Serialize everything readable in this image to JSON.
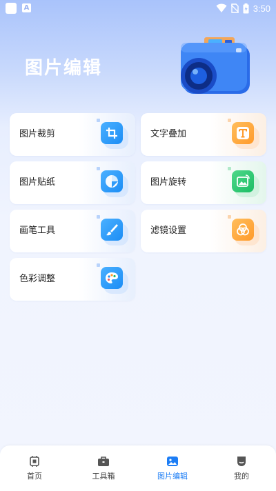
{
  "status_bar": {
    "time": "3:50",
    "a_icon": "A"
  },
  "hero": {
    "title": "图片编辑",
    "image": "camera-illustration"
  },
  "tools": [
    {
      "label": "图片裁剪",
      "icon": "crop-icon",
      "color": "#1c8df5"
    },
    {
      "label": "文字叠加",
      "icon": "text-icon",
      "color": "#ff9a2a"
    },
    {
      "label": "图片贴纸",
      "icon": "sticker-icon",
      "color": "#1c8df5"
    },
    {
      "label": "图片旋转",
      "icon": "image-rotate-icon",
      "color": "#1cbd64"
    },
    {
      "label": "画笔工具",
      "icon": "brush-icon",
      "color": "#1c8df5"
    },
    {
      "label": "滤镜设置",
      "icon": "filter-icon",
      "color": "#ff9a2a"
    },
    {
      "label": "色彩调整",
      "icon": "palette-icon",
      "color": "#1c8df5"
    }
  ],
  "bottom_nav": {
    "items": [
      {
        "label": "首页",
        "icon": "home-chip-icon"
      },
      {
        "label": "工具箱",
        "icon": "toolbox-icon"
      },
      {
        "label": "图片编辑",
        "icon": "image-edit-icon",
        "active": true
      },
      {
        "label": "我的",
        "icon": "profile-icon"
      }
    ],
    "accent": "#1c7df5"
  }
}
